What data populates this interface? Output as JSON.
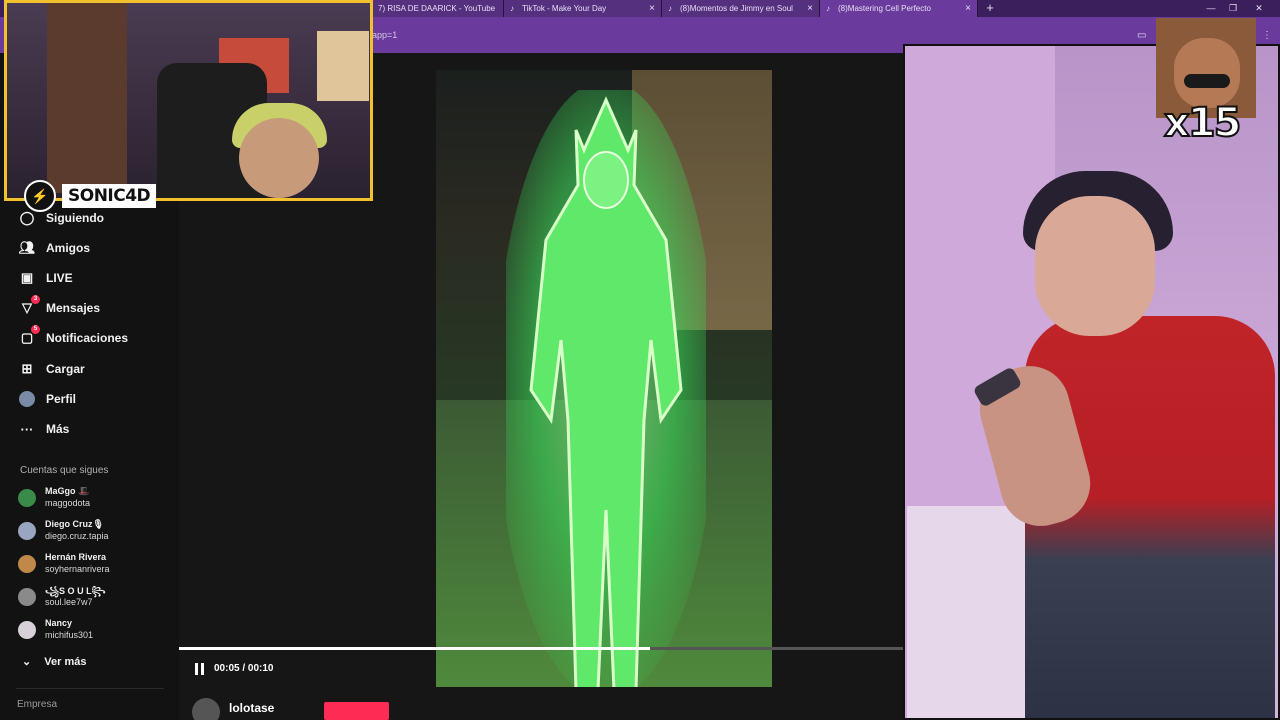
{
  "browser": {
    "tabs": [
      {
        "title": "7) RISA DE DAARICK - YouTube"
      },
      {
        "title": "TikTok - Make Your Day"
      },
      {
        "title": "(8)Momentos de Jimmy en Soul"
      },
      {
        "title": "(8)Mastering Cell Perfecto"
      }
    ],
    "url_fragment": "app=1"
  },
  "sidebar": {
    "items": [
      {
        "label": "Siguiendo",
        "icon": "following-icon"
      },
      {
        "label": "Amigos",
        "icon": "friends-icon"
      },
      {
        "label": "LIVE",
        "icon": "live-icon"
      },
      {
        "label": "Mensajes",
        "icon": "messages-icon",
        "badge": "3"
      },
      {
        "label": "Notificaciones",
        "icon": "bell-icon",
        "badge": "5"
      },
      {
        "label": "Cargar",
        "icon": "upload-icon"
      },
      {
        "label": "Perfil",
        "icon": "profile-icon"
      },
      {
        "label": "Más",
        "icon": "more-icon"
      }
    ],
    "following_title": "Cuentas que sigues",
    "following": [
      {
        "name": "MaGgo 🎩",
        "handle": "maggodota"
      },
      {
        "name": "Diego Cruz🎙",
        "handle": "diego.cruz.tapia"
      },
      {
        "name": "Hernán Rivera",
        "handle": "soyhernanrivera"
      },
      {
        "name": "꧁S O U L꧂",
        "handle": "soul.lee7w7"
      },
      {
        "name": "Nancy",
        "handle": "michifus301"
      }
    ],
    "see_more": "Ver más",
    "company": "Empresa"
  },
  "player": {
    "time": "00:05 / 00:10",
    "progress": 0.65,
    "author": "lolotase"
  },
  "overlay": {
    "streamer_name": "SONIC4D",
    "multiplier": "x15"
  },
  "colors": {
    "accent": "#fe2c55",
    "cam_border": "#f2c12e",
    "chrome": "#6a3a9c"
  }
}
